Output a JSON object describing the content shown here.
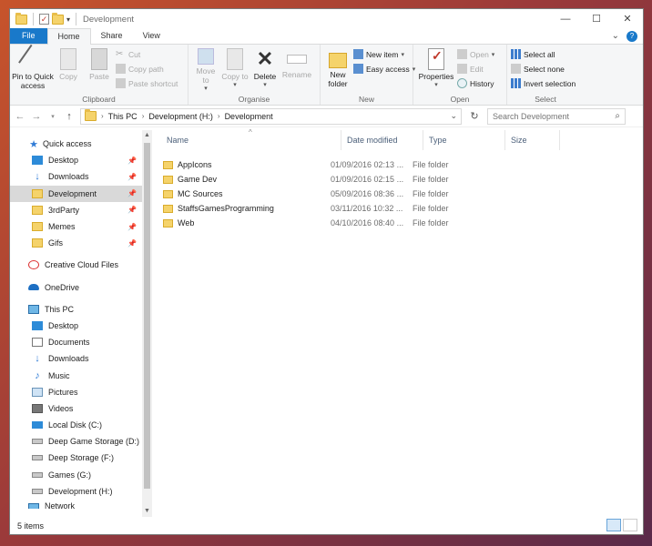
{
  "window": {
    "title": "Development",
    "controls": [
      "minimize",
      "maximize",
      "close"
    ]
  },
  "ribbon_tabs": [
    {
      "label": "File"
    },
    {
      "label": "Home"
    },
    {
      "label": "Share"
    },
    {
      "label": "View"
    }
  ],
  "ribbon": {
    "clipboard": {
      "label": "Clipboard",
      "pin": "Pin to Quick access",
      "copy": "Copy",
      "paste": "Paste",
      "cut": "Cut",
      "copy_path": "Copy path",
      "paste_shortcut": "Paste shortcut"
    },
    "organise": {
      "label": "Organise",
      "move_to": "Move to",
      "copy_to": "Copy to",
      "delete": "Delete",
      "rename": "Rename"
    },
    "new": {
      "label": "New",
      "new_folder": "New folder",
      "new_item": "New item",
      "easy_access": "Easy access"
    },
    "open": {
      "label": "Open",
      "properties": "Properties",
      "open": "Open",
      "edit": "Edit",
      "history": "History"
    },
    "select": {
      "label": "Select",
      "select_all": "Select all",
      "select_none": "Select none",
      "invert": "Invert selection"
    }
  },
  "address": {
    "crumbs": [
      "This PC",
      "Development (H:)",
      "Development"
    ],
    "search_placeholder": "Search Development"
  },
  "nav": {
    "quick_access": "Quick access",
    "quick_items": [
      {
        "label": "Desktop",
        "icon": "desktop-icon"
      },
      {
        "label": "Downloads",
        "icon": "download-icon"
      },
      {
        "label": "Development",
        "icon": "folder-icon"
      },
      {
        "label": "3rdParty",
        "icon": "folder-icon"
      },
      {
        "label": "Memes",
        "icon": "folder-icon"
      },
      {
        "label": "Gifs",
        "icon": "folder-icon"
      }
    ],
    "creative_cloud": "Creative Cloud Files",
    "onedrive": "OneDrive",
    "this_pc": "This PC",
    "pc_items": [
      {
        "label": "Desktop",
        "icon": "desktop-icon"
      },
      {
        "label": "Documents",
        "icon": "documents-icon"
      },
      {
        "label": "Downloads",
        "icon": "download-icon"
      },
      {
        "label": "Music",
        "icon": "music-icon"
      },
      {
        "label": "Pictures",
        "icon": "pictures-icon"
      },
      {
        "label": "Videos",
        "icon": "videos-icon"
      },
      {
        "label": "Local Disk (C:)",
        "icon": "system-drive-icon"
      },
      {
        "label": "Deep Game Storage (D:)",
        "icon": "drive-icon"
      },
      {
        "label": "Deep Storage (F:)",
        "icon": "drive-icon"
      },
      {
        "label": "Games (G:)",
        "icon": "drive-icon"
      },
      {
        "label": "Development (H:)",
        "icon": "drive-icon"
      }
    ],
    "network_partial": "Network"
  },
  "columns": [
    "Name",
    "Date modified",
    "Type",
    "Size"
  ],
  "files": [
    {
      "name": "AppIcons",
      "date": "01/09/2016 02:13 ...",
      "type": "File folder"
    },
    {
      "name": "Game Dev",
      "date": "01/09/2016 02:15 ...",
      "type": "File folder"
    },
    {
      "name": "MC Sources",
      "date": "05/09/2016 08:36 ...",
      "type": "File folder"
    },
    {
      "name": "StaffsGamesProgramming",
      "date": "03/11/2016 10:32 ...",
      "type": "File folder"
    },
    {
      "name": "Web",
      "date": "04/10/2016 08:40 ...",
      "type": "File folder"
    }
  ],
  "status": {
    "item_count": "5 items"
  },
  "colors": {
    "accent": "#1979ca",
    "folder": "#f5d36b",
    "selected": "#d9d9d9"
  }
}
